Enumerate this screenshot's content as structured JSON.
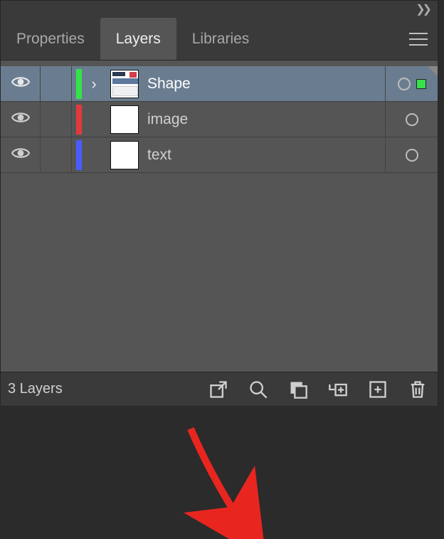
{
  "tabs": {
    "properties": "Properties",
    "layers": "Layers",
    "libraries": "Libraries"
  },
  "layers": [
    {
      "name": "Shape",
      "color": "#35e24a",
      "selected": true,
      "expandable": true,
      "selectionColor": "#35e24a"
    },
    {
      "name": "image",
      "color": "#e23a3a",
      "selected": false,
      "expandable": false
    },
    {
      "name": "text",
      "color": "#4a5cff",
      "selected": false,
      "expandable": false
    }
  ],
  "footer": {
    "count_label": "3 Layers"
  }
}
